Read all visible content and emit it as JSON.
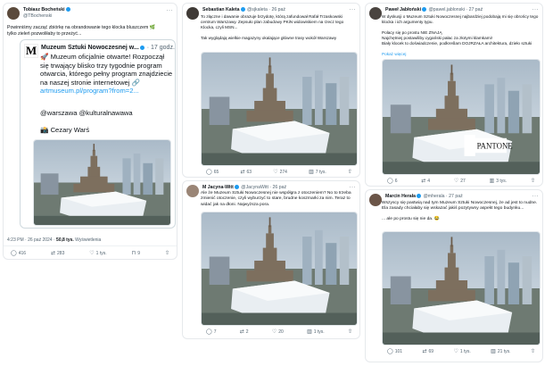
{
  "colors": {
    "accent": "#1d9bf0",
    "text": "#0f1419",
    "muted": "#536471",
    "sky": "#b9c7d3"
  },
  "post1": {
    "name": "Tobiasz Bocheński",
    "handle": "@TBochenski",
    "text": "Powinniśmy zacząć zbiórkę na obrandowanie tego klocka bluszczem 🌿\ntylko zieleń pozwoliłaby to przeżyć...",
    "quote": {
      "name": "Muzeum Sztuki Nowoczesnej w...",
      "time": "· 17 godz.",
      "text": "🚀 Muzeum oficjalnie otwarte! Rozpoczął się trwający blisko trzy tygodnie program otwarcia, którego pełny program znajdziecie na naszej stronie internetowej 🔗",
      "link": "artmuseum.pl/program?from=2...",
      "mentions": "@warszawa @kulturalnawawa",
      "credit": "📸 Cezary Warś"
    },
    "time": "4:23 PM · 26 paź 2024 · ",
    "views": "50,8 tys.",
    "views_label": " Wyświetlenia",
    "stats": {
      "replies": "416",
      "reposts": "283",
      "likes": "1 tys.",
      "bookmarks": "9"
    }
  },
  "post2": {
    "name": "Sebastian Kaleta",
    "handle": "@sjkaleta · 26 paź",
    "text": "To złączne i dawanie obrazuje brzydotę, którą zafundował Rafał Trzaskowski centrum Warszawy. Zepsuło plan zabudowy PKiN widowiskiem na rzecz tego Klocka, czyli MSN...\n\nTak wyglądają wielkie magazyny okalające główne trasy wokół Warszawy",
    "stats": {
      "replies": "65",
      "reposts": "63",
      "likes": "274",
      "views": "7 tys."
    }
  },
  "post3": {
    "name": "M Jacyna-Witt",
    "handle": "@JacynaWitt · 26 paź",
    "text": "Ale że Muzeum Sztuki Nowoczesnej nie współgra z otoczeniem? No to trzeba zmienić otoczenie, czyli wyburzyć to stare, brudne koszmarki za nim. Teraz to widać jak na dłoni. Najwyższa pora.",
    "stats": {
      "replies": "7",
      "reposts": "2",
      "likes": "20",
      "views": "1 tys."
    }
  },
  "post4": {
    "name": "Paweł Jabłoński",
    "handle": "@pawel.jablonski · 27 paź",
    "text": "W dyskusji o Muzeum Sztuki Nowoczesnej najbardziej podobają mi się obrońcy tego klocka i ich argumenty typu.\n\nPolacy się po prostu NIE ZNAJĄ\nNajchętniej postawiliby cygański pałac za złotymi klamkami!\nBiały klocek to doświadczenie, podkreślam DOJRZAŁA architektura, dzieło sztuki",
    "more": "Pokaż więcej",
    "sign": "PANTONE",
    "stats": {
      "replies": "6",
      "reposts": "4",
      "likes": "27",
      "views": "3 tys."
    }
  },
  "post5": {
    "name": "Marcin Herała",
    "handle": "@mherala · 27 paź",
    "text": "Wszyscy się pastwią nad tym Muzeum Sztuki Nowoczesnej, że ad jest to nudne. Ela zasady chciałaby się wskazać jakiś pozytywny aspekt tego budynku...\n\n... ale po prostu się nie da. 😂",
    "stats": {
      "replies": "101",
      "reposts": "69",
      "likes": "1 tys.",
      "views": "21 tys."
    }
  }
}
